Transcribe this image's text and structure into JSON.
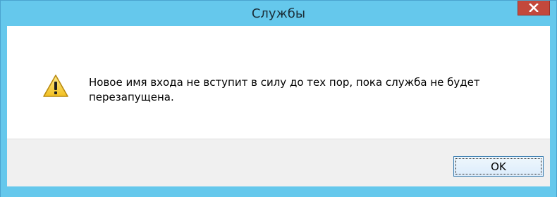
{
  "window": {
    "title": "Службы",
    "close_glyph": "x",
    "accent_color": "#65c8ec",
    "close_color": "#c3483c"
  },
  "dialog": {
    "icon": "warning-icon",
    "message": "Новое имя входа не вступит в силу до тех пор, пока служба не будет перезапущена."
  },
  "buttons": {
    "ok_label": "OK"
  }
}
